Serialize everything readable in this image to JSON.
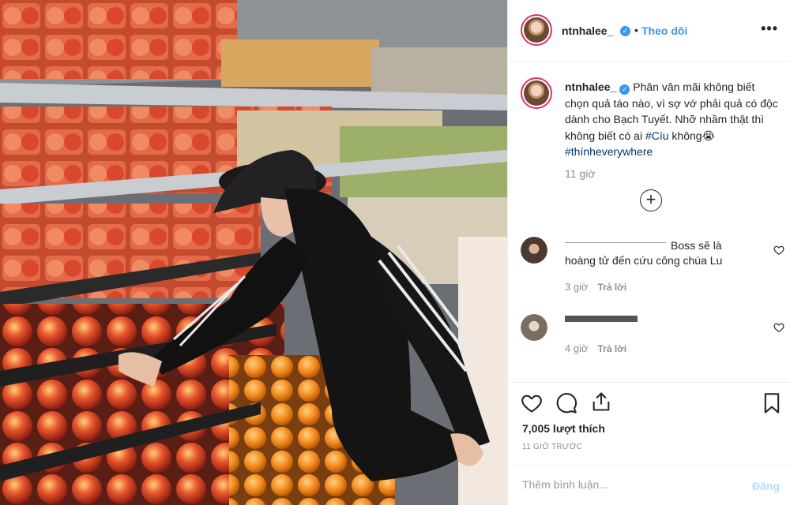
{
  "post": {
    "username": "ntnhalee_",
    "follow_label": "Theo dõi",
    "separator": "•",
    "more_label": "•••",
    "caption_text": "Phân vân mãi không biết chọn quả táo nào, vì sợ vớ phải quả có độc dành cho Bạch Tuyết. Nhỡ nhầm thật thì không biết có ai ",
    "caption_tag1": "#Cíu",
    "caption_mid": " không",
    "caption_emoji": "😭",
    "caption_tag2": "#thínheverywhere",
    "caption_time": "11 giờ",
    "load_more_label": "+"
  },
  "comments": [
    {
      "user": "",
      "text": "Boss sẽ là hoàng tử đến cứu công chúa Lu",
      "time": "3 giờ",
      "reply": "Trả lời"
    },
    {
      "user": "",
      "text": "",
      "time": "4 giờ",
      "reply": "Trả lời"
    }
  ],
  "actions": {
    "likes": "7,005 lượt thích",
    "time_ago": "11 GIỜ TRƯỚC",
    "comment_placeholder": "Thêm bình luận...",
    "post_label": "Đăng"
  },
  "icons": [
    "heart-icon",
    "comment-icon",
    "share-icon",
    "bookmark-icon",
    "verified-icon",
    "more-icon",
    "plus-circle-icon"
  ],
  "colors": {
    "link": "#3897f0",
    "hashtag": "#003569",
    "muted": "#8e8e8e",
    "post_disabled": "#b2dffc"
  }
}
